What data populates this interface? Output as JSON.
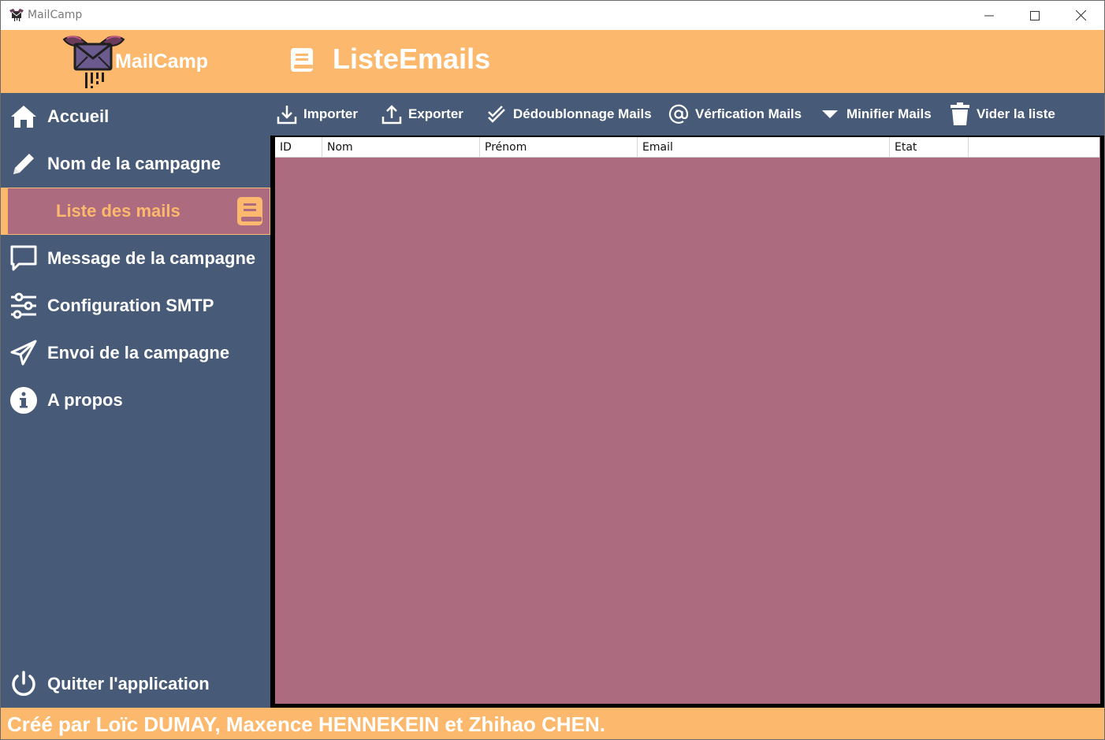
{
  "window": {
    "title": "MailCamp",
    "controls": [
      "minimize-icon",
      "maximize-icon",
      "close-icon"
    ]
  },
  "header": {
    "logo_text": "MailCamp",
    "page_title": "ListeEmails",
    "page_icon": "book-icon"
  },
  "sidebar": {
    "items": [
      {
        "label": "Accueil",
        "icon": "home-icon"
      },
      {
        "label": "Nom de la campagne",
        "icon": "pencil-icon"
      },
      {
        "label": "Liste des mails",
        "icon": "book-icon",
        "active": true
      },
      {
        "label": "Message de la campagne",
        "icon": "message-icon"
      },
      {
        "label": "Configuration SMTP",
        "icon": "sliders-icon"
      },
      {
        "label": "Envoi de la campagne",
        "icon": "send-icon"
      },
      {
        "label": "A propos",
        "icon": "info-icon"
      }
    ],
    "quit_label": "Quitter l'application"
  },
  "toolbar": {
    "import_label": "Importer",
    "export_label": "Exporter",
    "dedup_label": "Dédoublonnage Mails",
    "verify_label": "Vérfication Mails",
    "minify_label": "Minifier Mails",
    "clear_label": "Vider la liste"
  },
  "table": {
    "columns": [
      "ID",
      "Nom",
      "Prénom",
      "Email",
      "Etat"
    ],
    "rows": []
  },
  "footer": {
    "credits": "Créé par Loïc DUMAY, Maxence HENNEKEIN et Zhihao CHEN."
  },
  "colors": {
    "accent": "#fcb96e",
    "sidebar": "#475b78",
    "grid_bg": "#ad6b7f"
  }
}
